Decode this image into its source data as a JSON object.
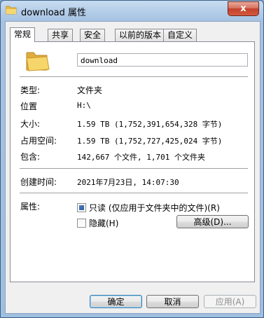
{
  "window": {
    "title": "download 属性",
    "close_glyph": "x"
  },
  "tabs": [
    {
      "label": "常规",
      "active": true
    },
    {
      "label": "共享"
    },
    {
      "label": "安全"
    },
    {
      "label": "以前的版本"
    },
    {
      "label": "自定义"
    }
  ],
  "general": {
    "name": "download",
    "type_label": "类型:",
    "type_value": "文件夹",
    "location_label": "位置",
    "location_value": "H:\\",
    "size_label": "大小:",
    "size_value": "1.59 TB (1,752,391,654,328 字节)",
    "disk_label": "占用空间:",
    "disk_value": "1.59 TB (1,752,727,425,024 字节)",
    "contains_label": "包含:",
    "contains_value": "142,667 个文件, 1,701 个文件夹",
    "created_label": "创建时间:",
    "created_value": "2021年7月23日, 14:07:30",
    "attributes_label": "属性:",
    "readonly_label": "只读 (仅应用于文件夹中的文件)(R)",
    "hidden_label": "隐藏(H)",
    "advanced_label": "高级(D)..."
  },
  "buttons": {
    "ok": "确定",
    "cancel": "取消",
    "apply": "应用(A)"
  },
  "icons": {
    "app": "folder-icon",
    "close": "close-icon"
  },
  "colors": {
    "title_bg": "#a6c2e2",
    "close_red": "#c2402b",
    "folder_yellow": "#f2cf5b"
  }
}
